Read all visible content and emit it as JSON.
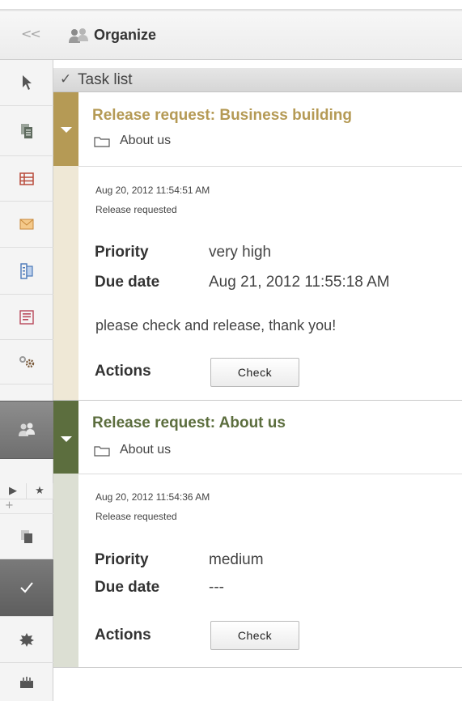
{
  "header": {
    "collapse_glyph": "<<",
    "title": "Organize",
    "icon": "users-icon"
  },
  "left_rail": {
    "items": [
      {
        "name": "pointer-icon"
      },
      {
        "name": "pages-icon"
      },
      {
        "name": "table-layout-icon"
      },
      {
        "name": "mail-icon"
      },
      {
        "name": "document-tree-icon"
      },
      {
        "name": "report-icon"
      },
      {
        "name": "settings-gears-icon"
      },
      {
        "name": "users-icon",
        "active": true
      },
      {
        "name": "play-icon"
      },
      {
        "name": "star-icon"
      },
      {
        "name": "add-icon"
      },
      {
        "name": "copy-icon"
      },
      {
        "name": "checkmark-icon",
        "active": true
      },
      {
        "name": "puzzle-icon"
      },
      {
        "name": "archive-icon"
      }
    ],
    "mini_play": "▶",
    "mini_star": "★",
    "plus": "+"
  },
  "tasklist": {
    "check_glyph": "✓",
    "label": "Task list"
  },
  "tasks": [
    {
      "title": "Release request: Business building",
      "folder": "About us",
      "timestamp": "Aug 20, 2012 11:54:51 AM",
      "status": "Release requested",
      "priority_label": "Priority",
      "priority": "very high",
      "due_label": "Due date",
      "due": "Aug 21, 2012 11:55:18 AM",
      "comment": "please check and release, thank you!",
      "actions_label": "Actions",
      "action_button": "Check",
      "color_head": "#b59a55",
      "color_body": "#efe8d6",
      "title_color": "#b59a55"
    },
    {
      "title": "Release request: About us",
      "folder": "About us",
      "timestamp": "Aug 20, 2012 11:54:36 AM",
      "status": "Release requested",
      "priority_label": "Priority",
      "priority": "medium",
      "due_label": "Due date",
      "due": "---",
      "actions_label": "Actions",
      "action_button": "Check",
      "color_head": "#5c6e3e",
      "color_body": "#dcdfd3",
      "title_color": "#5c6e3e"
    }
  ]
}
